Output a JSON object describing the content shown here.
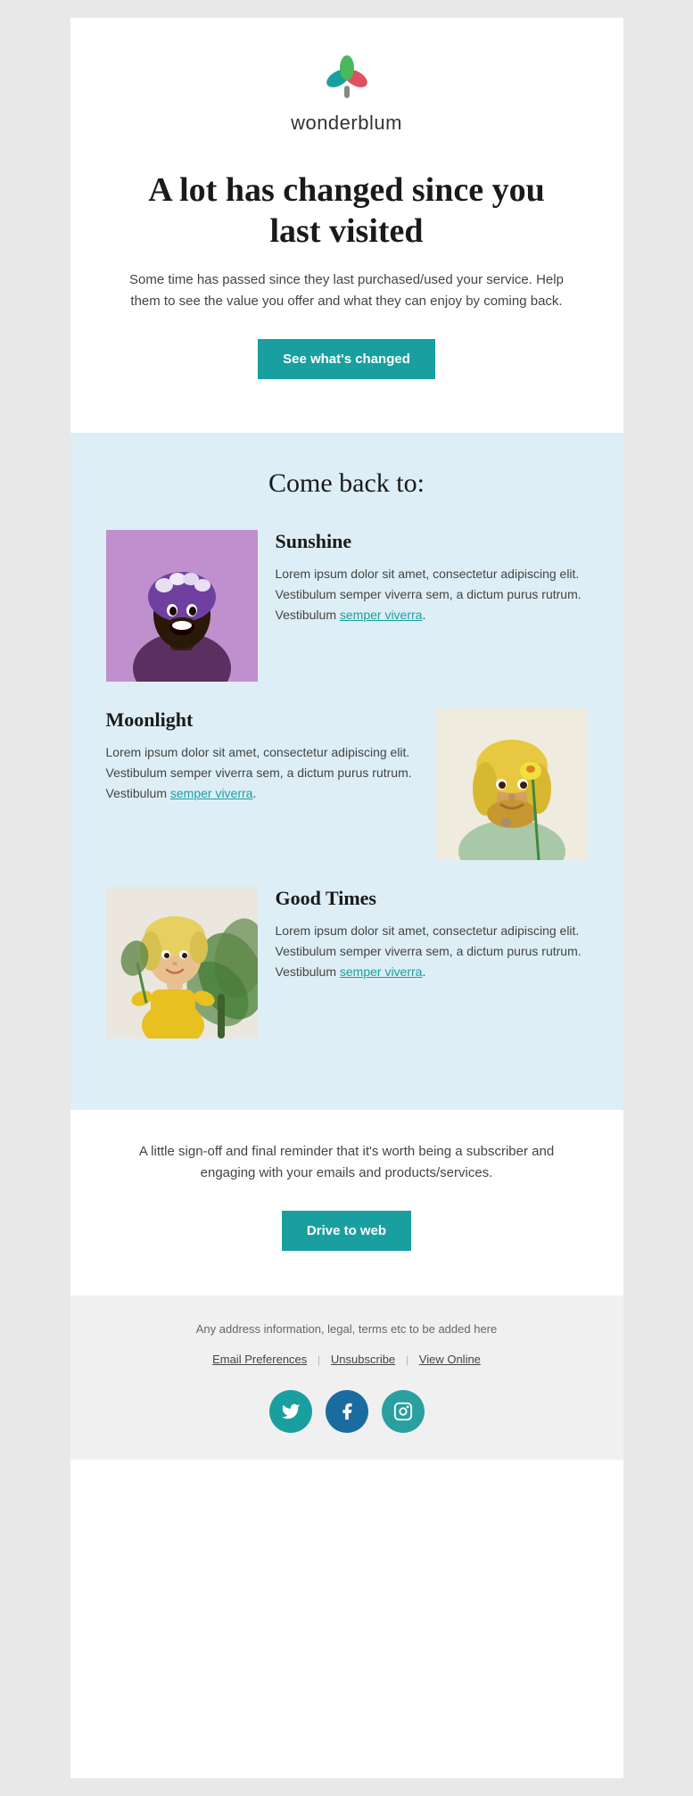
{
  "brand": {
    "name": "wonderblum",
    "logo_alt": "wonderblum logo"
  },
  "hero": {
    "title": "A lot has changed since you last visited",
    "body": "Some time has passed since they last purchased/used your service. Help them to see the value you offer and what they can enjoy by coming back.",
    "cta_label": "See what's changed"
  },
  "come_back": {
    "section_title": "Come back to:",
    "features": [
      {
        "id": "sunshine",
        "title": "Sunshine",
        "body": "Lorem ipsum dolor sit amet, consectetur adipiscing elit. Vestibulum semper viverra sem, a dictum purus rutrum. Vestibulum",
        "link_text": "semper viverra",
        "link_suffix": "."
      },
      {
        "id": "moonlight",
        "title": "Moonlight",
        "body": "Lorem ipsum dolor sit amet, consectetur adipiscing elit. Vestibulum semper viverra sem, a dictum purus rutrum. Vestibulum",
        "link_text": "semper viverra",
        "link_suffix": "."
      },
      {
        "id": "good-times",
        "title": "Good Times",
        "body": "Lorem ipsum dolor sit amet, consectetur adipiscing elit. Vestibulum semper viverra sem, a dictum purus rutrum. Vestibulum",
        "link_text": "semper viverra",
        "link_suffix": "."
      }
    ]
  },
  "signoff": {
    "text": "A little sign-off and final reminder that it's worth being a subscriber and engaging with your emails and products/services.",
    "cta_label": "Drive to web"
  },
  "footer": {
    "address": "Any address information, legal, terms etc to be added here",
    "links": [
      {
        "label": "Email Preferences",
        "name": "email-preferences-link"
      },
      {
        "label": "Unsubscribe",
        "name": "unsubscribe-link"
      },
      {
        "label": "View Online",
        "name": "view-online-link"
      }
    ],
    "social": [
      {
        "platform": "twitter",
        "icon": "twitter"
      },
      {
        "platform": "facebook",
        "icon": "facebook"
      },
      {
        "platform": "instagram",
        "icon": "instagram"
      }
    ]
  },
  "colors": {
    "teal": "#1a9fa0",
    "light_blue_bg": "#ddeef6",
    "footer_bg": "#f0f0f0"
  }
}
